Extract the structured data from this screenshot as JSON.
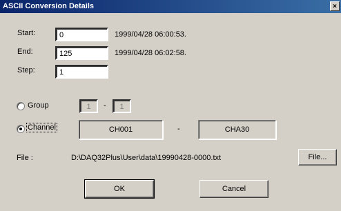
{
  "window": {
    "title": "ASCII Conversion Details",
    "close_label": "×"
  },
  "start": {
    "label": "Start:",
    "value": "0",
    "timestamp": "1999/04/28 06:00:53."
  },
  "end": {
    "label": "End:",
    "value": "125",
    "timestamp": "1999/04/28 06:02:58."
  },
  "step": {
    "label": "Step:",
    "value": "1"
  },
  "group": {
    "label": "Group",
    "from": "1",
    "separator": "-",
    "to": "1",
    "selected": false
  },
  "channel": {
    "label": "Channel",
    "from": "CH001",
    "separator": "-",
    "to": "CHA30",
    "selected": true
  },
  "file": {
    "label": "File :",
    "path": "D:\\DAQ32Plus\\User\\data\\19990428-0000.txt",
    "button_label": "File..."
  },
  "buttons": {
    "ok_label": "OK",
    "cancel_label": "Cancel"
  },
  "colors": {
    "titlebar_start": "#0a246a",
    "titlebar_end": "#3a6ea5",
    "face": "#d4d0c8"
  }
}
